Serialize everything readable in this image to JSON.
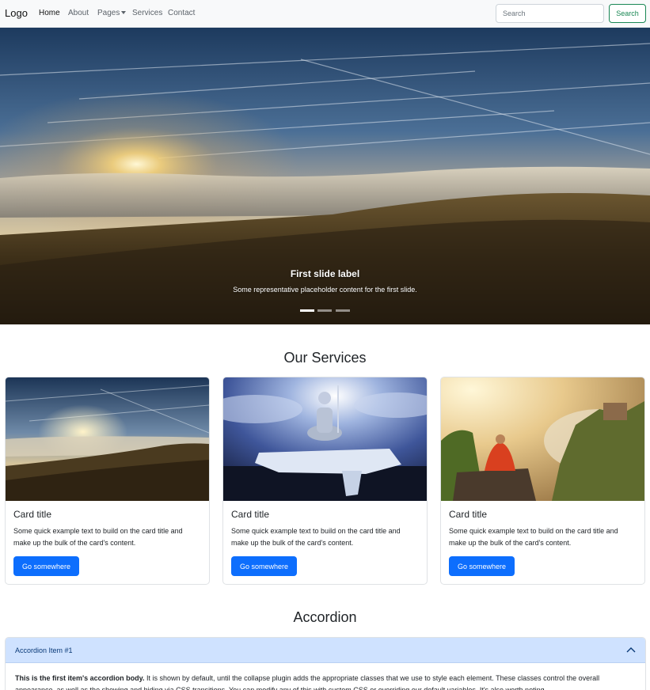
{
  "navbar": {
    "brand": "Logo",
    "links": [
      {
        "label": "Home"
      },
      {
        "label": "About"
      },
      {
        "label": "Pages"
      },
      {
        "label": "Services"
      },
      {
        "label": "Contact"
      }
    ],
    "search_placeholder": "Search",
    "search_button": "Search"
  },
  "carousel": {
    "slide_title": "First slide label",
    "slide_text": "Some representative placeholder content for the first slide.",
    "indicator_count": 3,
    "active_index": 0
  },
  "services": {
    "heading": "Our Services",
    "cards": [
      {
        "title": "Card title",
        "text": "Some quick example text to build on the card title and make up the bulk of the card's content.",
        "button": "Go somewhere",
        "image": "mountain-sunset"
      },
      {
        "title": "Card title",
        "text": "Some quick example text to build on the card title and make up the bulk of the card's content.",
        "button": "Go somewhere",
        "image": "meditation-statue-ice"
      },
      {
        "title": "Card title",
        "text": "Some quick example text to build on the card title and make up the bulk of the card's content.",
        "button": "Go somewhere",
        "image": "monk-on-cliff"
      }
    ]
  },
  "accordion": {
    "heading": "Accordion",
    "items": [
      {
        "label": "Accordion Item #1",
        "expanded": true,
        "body_strong": "This is the first item's accordion body.",
        "body_text": " It is shown by default, until the collapse plugin adds the appropriate classes that we use to style each element. These classes control the overall appearance, as well as the showing and hiding via CSS transitions. You can modify any of this with custom CSS or overriding our default variables. It's also worth noting"
      }
    ]
  },
  "colors": {
    "primary": "#0d6efd",
    "success": "#198754",
    "navbar_bg": "#f8f9fa",
    "accordion_active_bg": "#cfe2ff"
  }
}
